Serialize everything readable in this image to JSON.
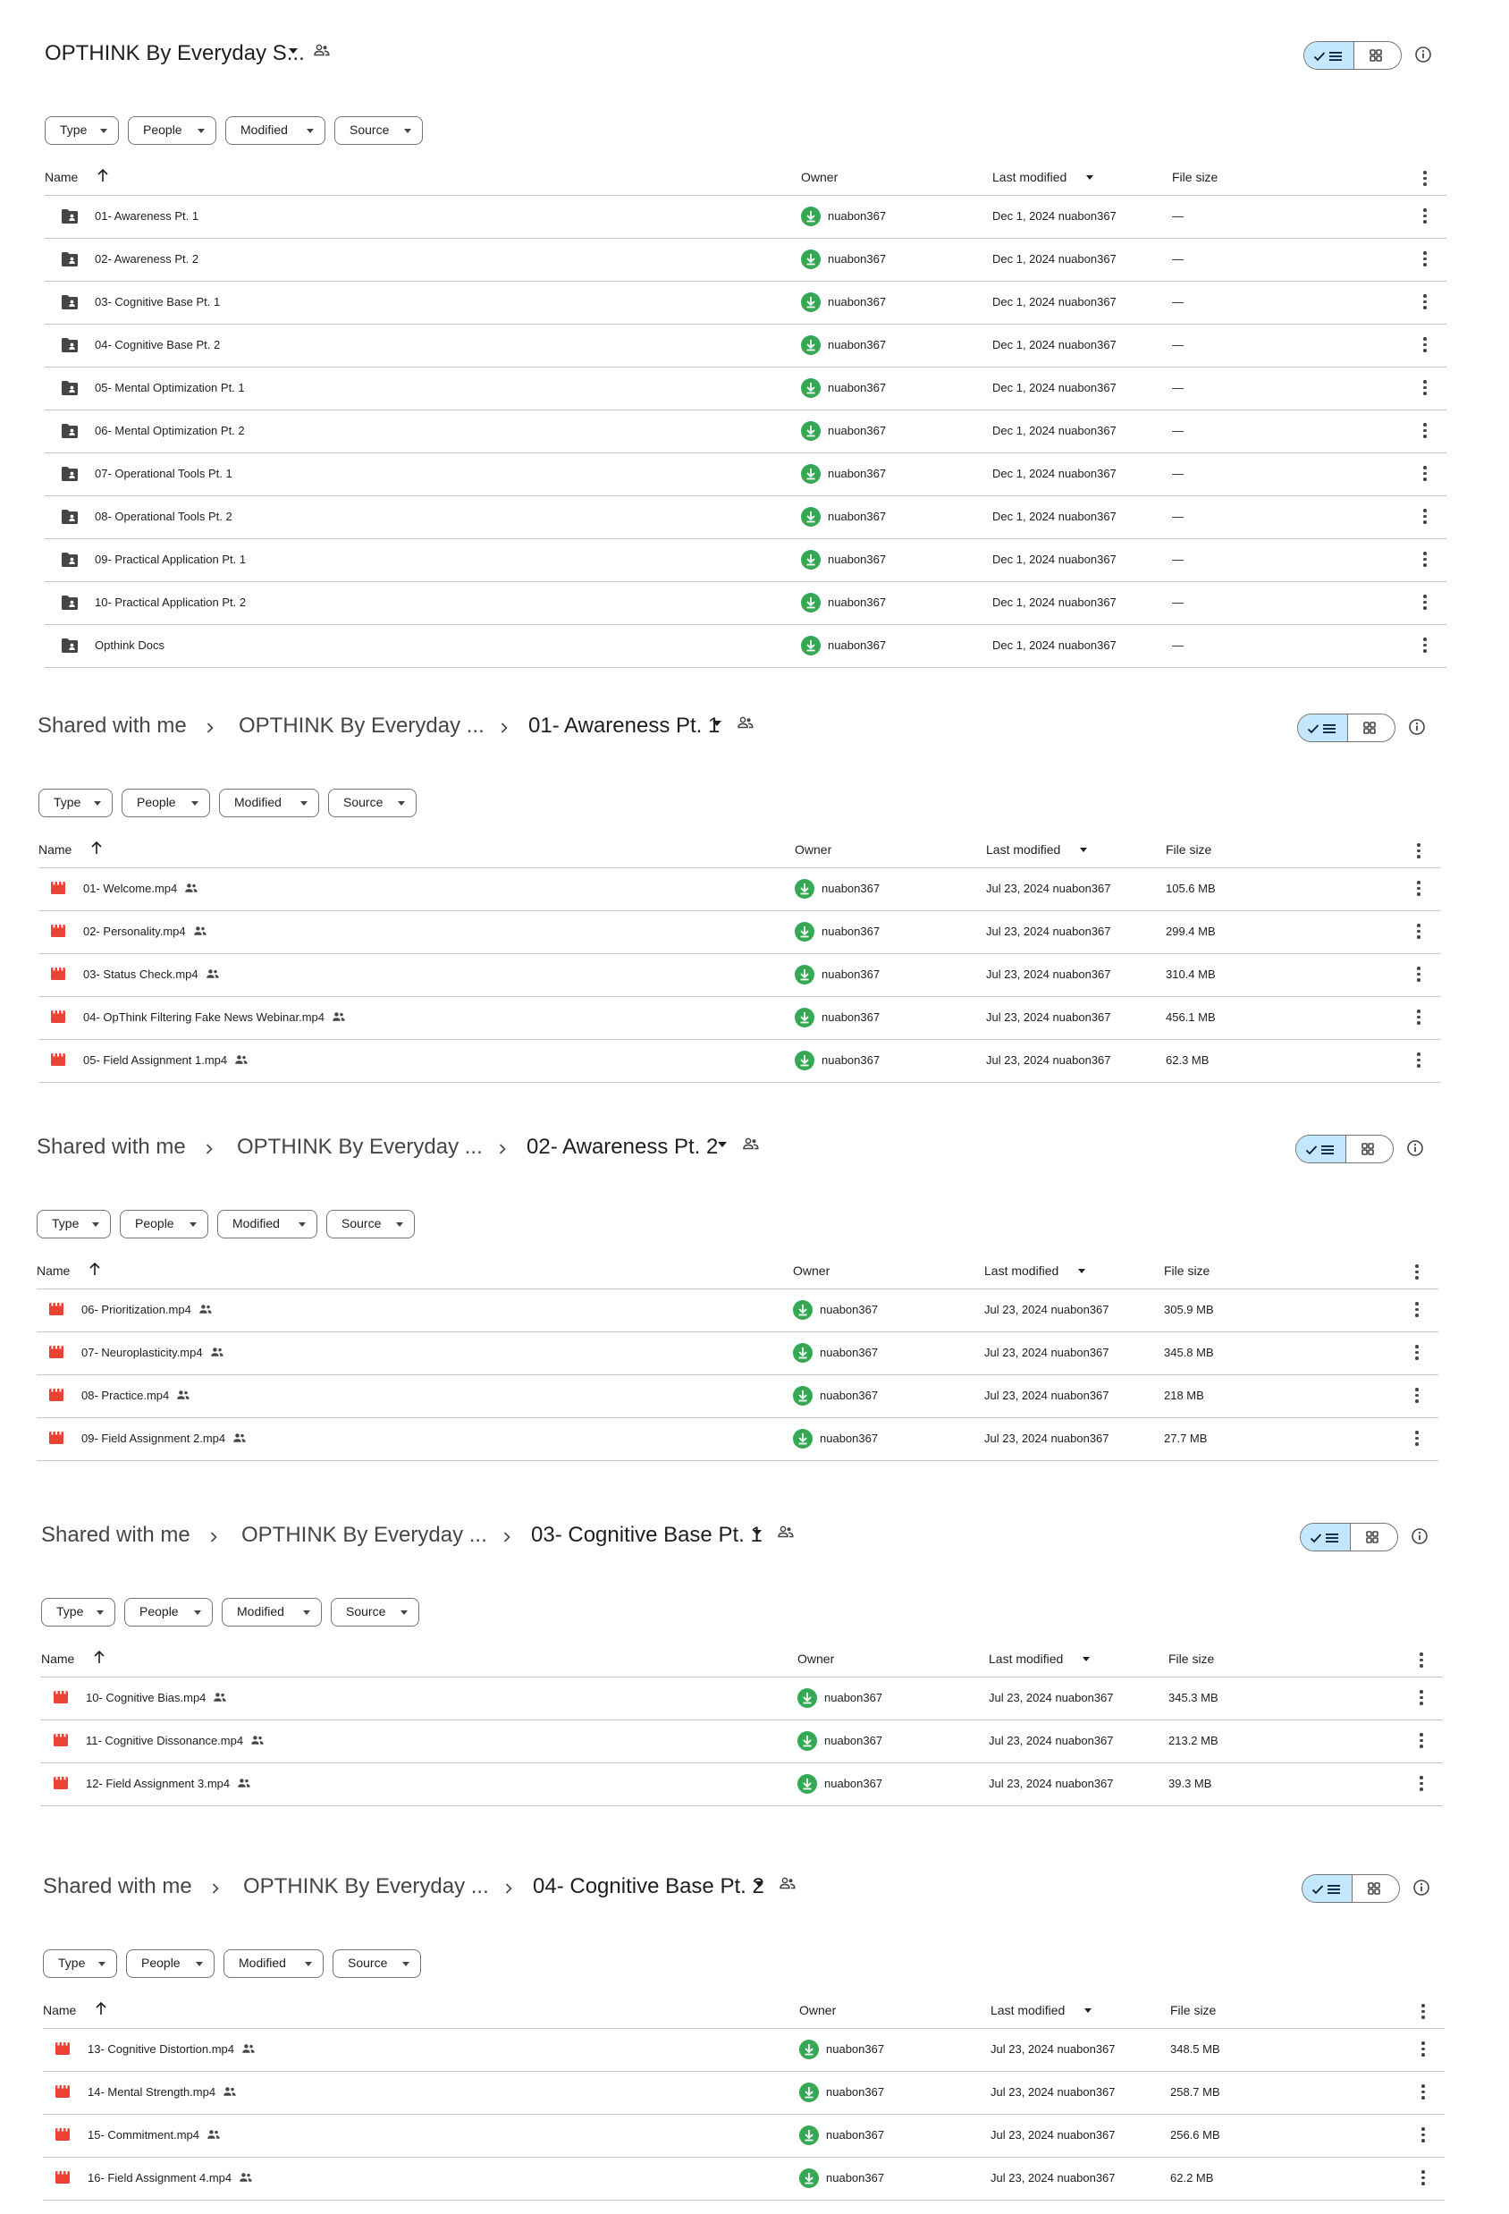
{
  "colors": {
    "accent_bg": "#c2e7ff",
    "owner_avatar": "#34a853",
    "video_icon": "#ea4335",
    "folder_icon": "#444746"
  },
  "filters": [
    "Type",
    "People",
    "Modified",
    "Source"
  ],
  "columns": {
    "name": "Name",
    "owner": "Owner",
    "modified": "Last modified",
    "size": "File size"
  },
  "sections": [
    {
      "title": "OPTHINK By Everyday S...",
      "rows": [
        {
          "name": "01- Awareness Pt. 1",
          "owner": "nuabon367",
          "modified": "Dec 1, 2024 nuabon367",
          "size": "—",
          "icon": "folder-icon"
        },
        {
          "name": "02- Awareness Pt. 2",
          "owner": "nuabon367",
          "modified": "Dec 1, 2024 nuabon367",
          "size": "—",
          "icon": "folder-icon"
        },
        {
          "name": "03- Cognitive Base Pt. 1",
          "owner": "nuabon367",
          "modified": "Dec 1, 2024 nuabon367",
          "size": "—",
          "icon": "folder-icon"
        },
        {
          "name": "04- Cognitive Base Pt. 2",
          "owner": "nuabon367",
          "modified": "Dec 1, 2024 nuabon367",
          "size": "—",
          "icon": "folder-icon"
        },
        {
          "name": "05- Mental Optimization Pt. 1",
          "owner": "nuabon367",
          "modified": "Dec 1, 2024 nuabon367",
          "size": "—",
          "icon": "folder-icon"
        },
        {
          "name": "06- Mental Optimization Pt. 2",
          "owner": "nuabon367",
          "modified": "Dec 1, 2024 nuabon367",
          "size": "—",
          "icon": "folder-icon"
        },
        {
          "name": "07- Operational Tools Pt. 1",
          "owner": "nuabon367",
          "modified": "Dec 1, 2024 nuabon367",
          "size": "—",
          "icon": "folder-icon"
        },
        {
          "name": "08- Operational Tools Pt. 2",
          "owner": "nuabon367",
          "modified": "Dec 1, 2024 nuabon367",
          "size": "—",
          "icon": "folder-icon"
        },
        {
          "name": "09- Practical Application Pt. 1",
          "owner": "nuabon367",
          "modified": "Dec 1, 2024 nuabon367",
          "size": "—",
          "icon": "folder-icon"
        },
        {
          "name": "10- Practical Application Pt. 2",
          "owner": "nuabon367",
          "modified": "Dec 1, 2024 nuabon367",
          "size": "—",
          "icon": "folder-icon"
        },
        {
          "name": "Opthink Docs",
          "owner": "nuabon367",
          "modified": "Dec 1, 2024 nuabon367",
          "size": "—",
          "icon": "folder-icon"
        }
      ]
    },
    {
      "breadcrumb": [
        "Shared with me",
        "OPTHINK By Everyday ...",
        "01- Awareness Pt. 1"
      ],
      "rows": [
        {
          "name": "01- Welcome.mp4",
          "owner": "nuabon367",
          "modified": "Jul 23, 2024 nuabon367",
          "size": "105.6 MB",
          "icon": "video-icon"
        },
        {
          "name": "02- Personality.mp4",
          "owner": "nuabon367",
          "modified": "Jul 23, 2024 nuabon367",
          "size": "299.4 MB",
          "icon": "video-icon"
        },
        {
          "name": "03- Status Check.mp4",
          "owner": "nuabon367",
          "modified": "Jul 23, 2024 nuabon367",
          "size": "310.4 MB",
          "icon": "video-icon"
        },
        {
          "name": "04- OpThink Filtering Fake News Webinar.mp4",
          "owner": "nuabon367",
          "modified": "Jul 23, 2024 nuabon367",
          "size": "456.1 MB",
          "icon": "video-icon"
        },
        {
          "name": "05- Field Assignment 1.mp4",
          "owner": "nuabon367",
          "modified": "Jul 23, 2024 nuabon367",
          "size": "62.3 MB",
          "icon": "video-icon"
        }
      ]
    },
    {
      "breadcrumb": [
        "Shared with me",
        "OPTHINK By Everyday ...",
        "02- Awareness Pt. 2"
      ],
      "rows": [
        {
          "name": "06- Prioritization.mp4",
          "owner": "nuabon367",
          "modified": "Jul 23, 2024 nuabon367",
          "size": "305.9 MB",
          "icon": "video-icon"
        },
        {
          "name": "07- Neuroplasticity.mp4",
          "owner": "nuabon367",
          "modified": "Jul 23, 2024 nuabon367",
          "size": "345.8 MB",
          "icon": "video-icon"
        },
        {
          "name": "08- Practice.mp4",
          "owner": "nuabon367",
          "modified": "Jul 23, 2024 nuabon367",
          "size": "218 MB",
          "icon": "video-icon"
        },
        {
          "name": "09- Field Assignment 2.mp4",
          "owner": "nuabon367",
          "modified": "Jul 23, 2024 nuabon367",
          "size": "27.7 MB",
          "icon": "video-icon"
        }
      ]
    },
    {
      "breadcrumb": [
        "Shared with me",
        "OPTHINK By Everyday ...",
        "03- Cognitive Base Pt. 1"
      ],
      "rows": [
        {
          "name": "10- Cognitive Bias.mp4",
          "owner": "nuabon367",
          "modified": "Jul 23, 2024 nuabon367",
          "size": "345.3 MB",
          "icon": "video-icon"
        },
        {
          "name": "11- Cognitive Dissonance.mp4",
          "owner": "nuabon367",
          "modified": "Jul 23, 2024 nuabon367",
          "size": "213.2 MB",
          "icon": "video-icon"
        },
        {
          "name": "12- Field Assignment 3.mp4",
          "owner": "nuabon367",
          "modified": "Jul 23, 2024 nuabon367",
          "size": "39.3 MB",
          "icon": "video-icon"
        }
      ]
    },
    {
      "breadcrumb": [
        "Shared with me",
        "OPTHINK By Everyday ...",
        "04- Cognitive Base Pt. 2"
      ],
      "rows": [
        {
          "name": "13- Cognitive Distortion.mp4",
          "owner": "nuabon367",
          "modified": "Jul 23, 2024 nuabon367",
          "size": "348.5 MB",
          "icon": "video-icon"
        },
        {
          "name": "14- Mental Strength.mp4",
          "owner": "nuabon367",
          "modified": "Jul 23, 2024 nuabon367",
          "size": "258.7 MB",
          "icon": "video-icon"
        },
        {
          "name": "15- Commitment.mp4",
          "owner": "nuabon367",
          "modified": "Jul 23, 2024 nuabon367",
          "size": "256.6 MB",
          "icon": "video-icon"
        },
        {
          "name": "16- Field Assignment 4.mp4",
          "owner": "nuabon367",
          "modified": "Jul 23, 2024 nuabon367",
          "size": "62.2 MB",
          "icon": "video-icon"
        }
      ]
    }
  ]
}
